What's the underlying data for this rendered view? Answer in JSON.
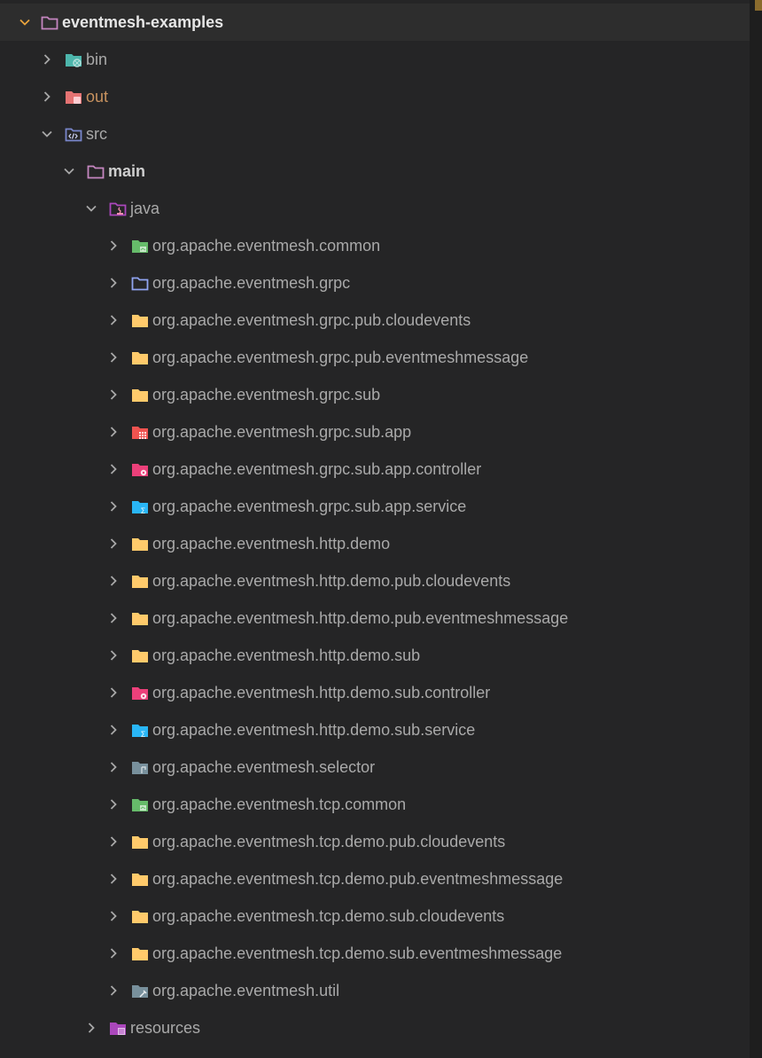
{
  "root": {
    "label": "eventmesh-examples",
    "icon": "folder-open-icon",
    "color": "#c586c0"
  },
  "items": [
    {
      "label": "bin",
      "icon": "folder-bin-icon",
      "color": "#4db6ac",
      "style": "normal",
      "expanded": false
    },
    {
      "label": "out",
      "icon": "folder-out-icon",
      "color": "#e57373",
      "style": "orange",
      "expanded": false
    },
    {
      "label": "src",
      "icon": "folder-src-icon",
      "color": "#7986cb",
      "style": "normal",
      "expanded": true
    },
    {
      "label": "main",
      "icon": "folder-main-icon",
      "color": "#c586c0",
      "style": "bold",
      "expanded": true
    },
    {
      "label": "java",
      "icon": "folder-java-icon",
      "color": "#ab47bc",
      "style": "normal",
      "expanded": true
    },
    {
      "label": "org.apache.eventmesh.common",
      "icon": "folder-common-icon",
      "color": "#66bb6a",
      "style": "normal",
      "expanded": false
    },
    {
      "label": "org.apache.eventmesh.grpc",
      "icon": "folder-outline-icon",
      "color": "#90a4f0",
      "style": "normal",
      "expanded": false
    },
    {
      "label": "org.apache.eventmesh.grpc.pub.cloudevents",
      "icon": "folder-icon",
      "color": "#ffca6b",
      "style": "normal",
      "expanded": false
    },
    {
      "label": "org.apache.eventmesh.grpc.pub.eventmeshmessage",
      "icon": "folder-icon",
      "color": "#ffca6b",
      "style": "normal",
      "expanded": false
    },
    {
      "label": "org.apache.eventmesh.grpc.sub",
      "icon": "folder-icon",
      "color": "#ffca6b",
      "style": "normal",
      "expanded": false
    },
    {
      "label": "org.apache.eventmesh.grpc.sub.app",
      "icon": "folder-app-icon",
      "color": "#ef5350",
      "style": "normal",
      "expanded": false
    },
    {
      "label": "org.apache.eventmesh.grpc.sub.app.controller",
      "icon": "folder-controller-icon",
      "color": "#ec407a",
      "style": "normal",
      "expanded": false
    },
    {
      "label": "org.apache.eventmesh.grpc.sub.app.service",
      "icon": "folder-service-icon",
      "color": "#29b6f6",
      "style": "normal",
      "expanded": false
    },
    {
      "label": "org.apache.eventmesh.http.demo",
      "icon": "folder-icon",
      "color": "#ffca6b",
      "style": "normal",
      "expanded": false
    },
    {
      "label": "org.apache.eventmesh.http.demo.pub.cloudevents",
      "icon": "folder-icon",
      "color": "#ffca6b",
      "style": "normal",
      "expanded": false
    },
    {
      "label": "org.apache.eventmesh.http.demo.pub.eventmeshmessage",
      "icon": "folder-icon",
      "color": "#ffca6b",
      "style": "normal",
      "expanded": false
    },
    {
      "label": "org.apache.eventmesh.http.demo.sub",
      "icon": "folder-icon",
      "color": "#ffca6b",
      "style": "normal",
      "expanded": false
    },
    {
      "label": "org.apache.eventmesh.http.demo.sub.controller",
      "icon": "folder-controller-icon",
      "color": "#ec407a",
      "style": "normal",
      "expanded": false
    },
    {
      "label": "org.apache.eventmesh.http.demo.sub.service",
      "icon": "folder-service-icon",
      "color": "#29b6f6",
      "style": "normal",
      "expanded": false
    },
    {
      "label": "org.apache.eventmesh.selector",
      "icon": "folder-selector-icon",
      "color": "#78909c",
      "style": "normal",
      "expanded": false
    },
    {
      "label": "org.apache.eventmesh.tcp.common",
      "icon": "folder-common-icon",
      "color": "#66bb6a",
      "style": "normal",
      "expanded": false
    },
    {
      "label": "org.apache.eventmesh.tcp.demo.pub.cloudevents",
      "icon": "folder-icon",
      "color": "#ffca6b",
      "style": "normal",
      "expanded": false
    },
    {
      "label": "org.apache.eventmesh.tcp.demo.pub.eventmeshmessage",
      "icon": "folder-icon",
      "color": "#ffca6b",
      "style": "normal",
      "expanded": false
    },
    {
      "label": "org.apache.eventmesh.tcp.demo.sub.cloudevents",
      "icon": "folder-icon",
      "color": "#ffca6b",
      "style": "normal",
      "expanded": false
    },
    {
      "label": "org.apache.eventmesh.tcp.demo.sub.eventmeshmessage",
      "icon": "folder-icon",
      "color": "#ffca6b",
      "style": "normal",
      "expanded": false
    },
    {
      "label": "org.apache.eventmesh.util",
      "icon": "folder-util-icon",
      "color": "#78909c",
      "style": "normal",
      "expanded": false
    },
    {
      "label": "resources",
      "icon": "folder-resources-icon",
      "color": "#ab47bc",
      "style": "normal",
      "expanded": false
    }
  ]
}
